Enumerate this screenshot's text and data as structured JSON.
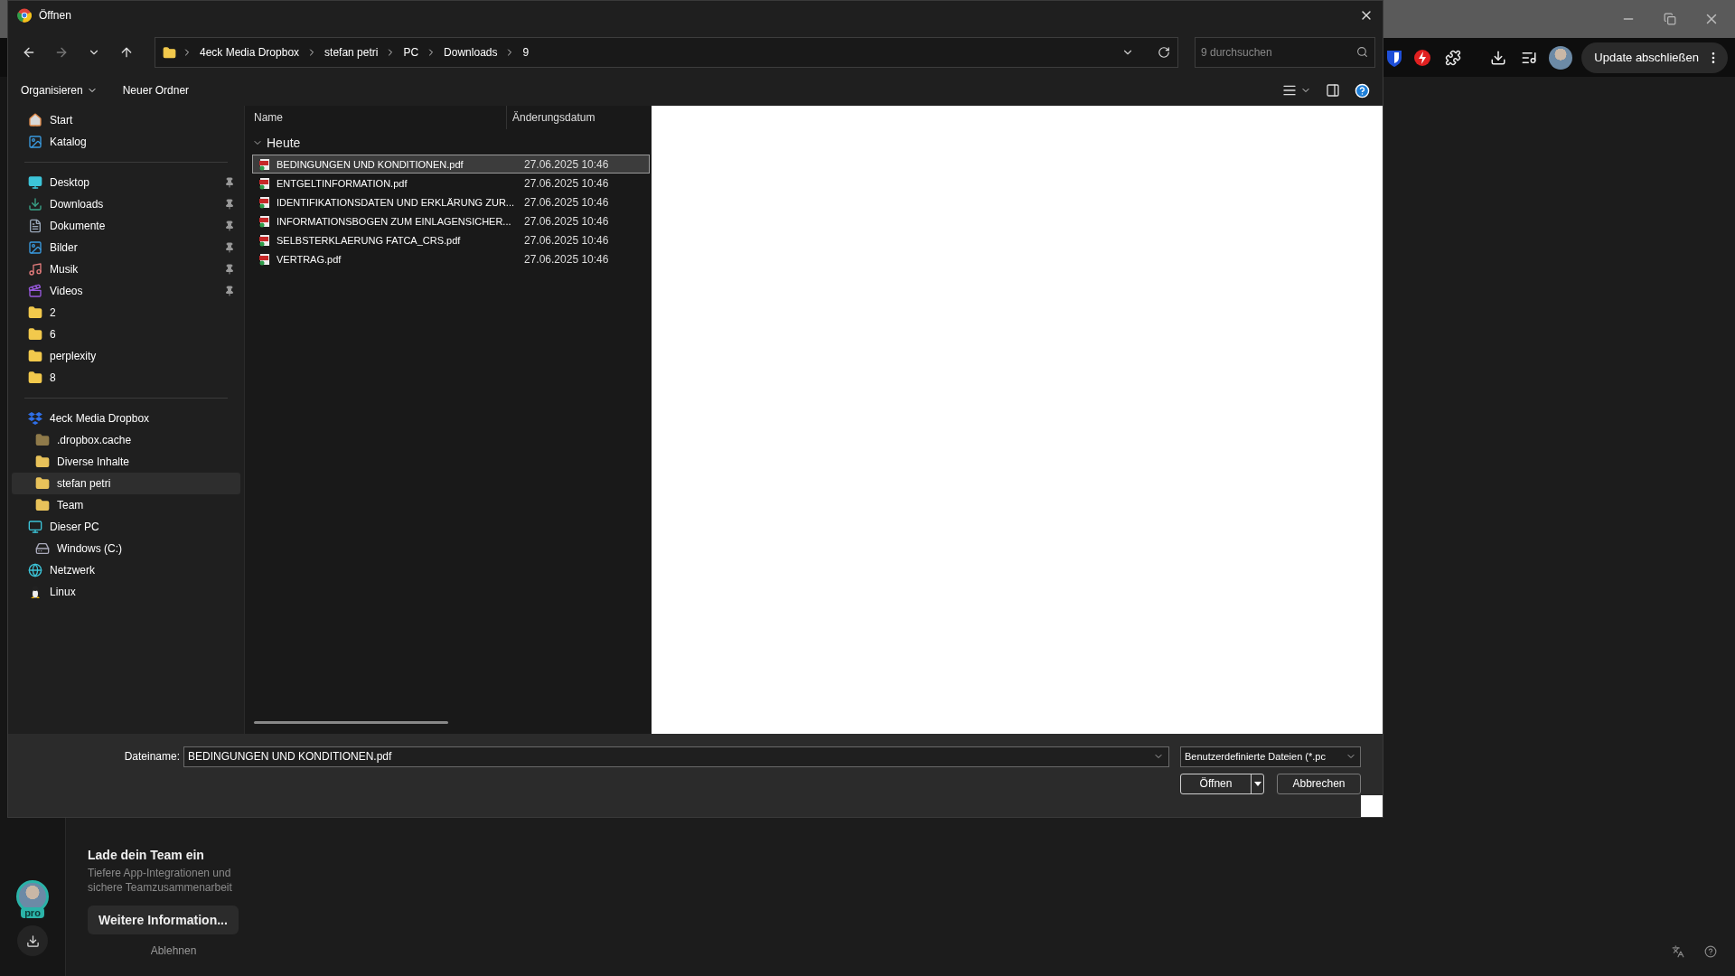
{
  "dialog": {
    "title": "Öffnen",
    "breadcrumb": [
      "4eck Media Dropbox",
      "stefan petri",
      "PC",
      "Downloads",
      "9"
    ],
    "search": {
      "placeholder": "9 durchsuchen"
    },
    "commands": [
      "Organisieren",
      "Neuer Ordner"
    ],
    "sidebar": [
      [
        {
          "label": "Start",
          "kind": "home",
          "selected": false
        },
        {
          "label": "Katalog",
          "kind": "gallery",
          "selected": false
        }
      ],
      [
        {
          "label": "Desktop",
          "kind": "desktop",
          "pinned": true,
          "selected": false
        },
        {
          "label": "Downloads",
          "kind": "download",
          "pinned": true,
          "selected": false
        },
        {
          "label": "Dokumente",
          "kind": "documents",
          "pinned": true,
          "selected": false
        },
        {
          "label": "Bilder",
          "kind": "pictures",
          "pinned": true,
          "selected": false
        },
        {
          "label": "Musik",
          "kind": "music",
          "pinned": true,
          "selected": false
        },
        {
          "label": "Videos",
          "kind": "videos",
          "pinned": true,
          "selected": false
        },
        {
          "label": "2",
          "kind": "folder",
          "pinned": false,
          "selected": false
        },
        {
          "label": "6",
          "kind": "folder",
          "pinned": false,
          "selected": false
        },
        {
          "label": "perplexity",
          "kind": "folder",
          "pinned": false,
          "selected": false
        },
        {
          "label": "8",
          "kind": "folder",
          "pinned": false,
          "selected": false
        }
      ],
      [
        {
          "label": "4eck Media Dropbox",
          "kind": "dropbox",
          "selected": false,
          "children": [
            {
              "label": ".dropbox.cache",
              "kind": "folder-dim",
              "selected": false
            },
            {
              "label": "Diverse Inhalte",
              "kind": "folder-shared",
              "selected": false
            },
            {
              "label": "stefan petri",
              "kind": "folder-shared",
              "selected": true
            },
            {
              "label": "Team",
              "kind": "folder-shared",
              "selected": false
            }
          ]
        },
        {
          "label": "Dieser PC",
          "kind": "pc",
          "selected": false,
          "children": [
            {
              "label": "Windows (C:)",
              "kind": "drive",
              "selected": false
            }
          ]
        },
        {
          "label": "Netzwerk",
          "kind": "network",
          "selected": false
        },
        {
          "label": "Linux",
          "kind": "linux",
          "selected": false
        }
      ]
    ],
    "columns": [
      "Name",
      "Änderungsdatum"
    ],
    "group": {
      "label": "Heute",
      "expanded": true
    },
    "files": [
      {
        "name": "BEDINGUNGEN UND KONDITIONEN.pdf",
        "date": "27.06.2025 10:46",
        "selected": true
      },
      {
        "name": "ENTGELTINFORMATION.pdf",
        "date": "27.06.2025 10:46",
        "selected": false
      },
      {
        "name": "IDENTIFIKATIONSDATEN UND ERKLÄRUNG ZUR...",
        "date": "27.06.2025 10:46",
        "selected": false
      },
      {
        "name": "INFORMATIONSBOGEN ZUM EINLAGENSICHER...",
        "date": "27.06.2025 10:46",
        "selected": false
      },
      {
        "name": "SELBSTERKLAERUNG FATCA_CRS.pdf",
        "date": "27.06.2025 10:46",
        "selected": false
      },
      {
        "name": "VERTRAG.pdf",
        "date": "27.06.2025 10:46",
        "selected": false
      }
    ],
    "filename": {
      "label": "Dateiname:",
      "value": "BEDINGUNGEN UND KONDITIONEN.pdf"
    },
    "filetype": "Benutzerdefinierte Dateien (*.pc",
    "buttons": [
      {
        "label": "Öffnen",
        "kind": "split"
      },
      {
        "label": "Abbrechen",
        "kind": "plain"
      }
    ]
  },
  "browser": {
    "update_button": "Update abschließen",
    "avatar_badge": "pro",
    "promo": {
      "title": "Lade dein Team ein",
      "text": "Tiefere App-Integrationen und sichere Teamzusammenarbeit",
      "button": "Weitere Information...",
      "dismiss": "Ablehnen"
    }
  }
}
